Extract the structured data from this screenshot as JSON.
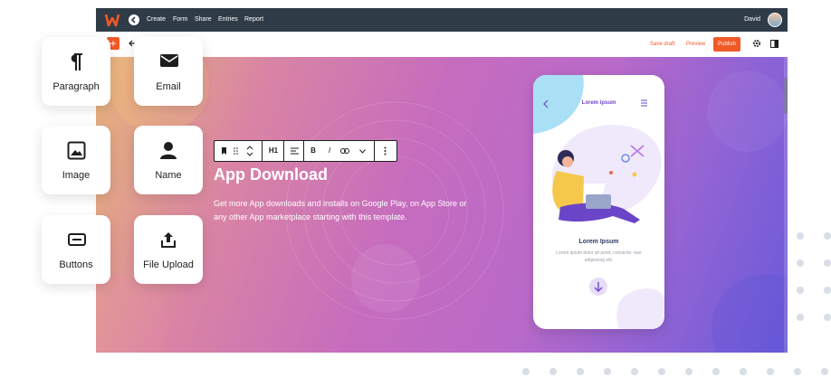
{
  "topbar": {
    "nav": [
      "Create",
      "Form",
      "Share",
      "Entries",
      "Report"
    ],
    "user_name": "David"
  },
  "toolbar": {
    "save_draft": "Save draft",
    "preview": "Preview",
    "publish": "Publish",
    "add_label": "+"
  },
  "block_toolbar": {
    "heading_level": "H1",
    "bold": "B",
    "italic": "I"
  },
  "hero": {
    "title": "App Download",
    "description": "Get more App downloads and installs on Google Play, on App Store or any other App marketplace starting with this template."
  },
  "phone": {
    "title": "Lorem ipsum",
    "heading": "Lorem Ipsum",
    "body": "Lorem ipsum dolor sit amet, consecte- tuer adipiscing elit."
  },
  "blocks": [
    {
      "label": "Paragraph",
      "icon": "paragraph-icon"
    },
    {
      "label": "Email",
      "icon": "email-icon"
    },
    {
      "label": "Image",
      "icon": "image-icon"
    },
    {
      "label": "Name",
      "icon": "person-icon"
    },
    {
      "label": "Buttons",
      "icon": "button-icon"
    },
    {
      "label": "File Upload",
      "icon": "upload-icon"
    }
  ],
  "colors": {
    "accent": "#f05a28",
    "topbar": "#2f3b47",
    "phone_accent": "#6b45c8"
  }
}
